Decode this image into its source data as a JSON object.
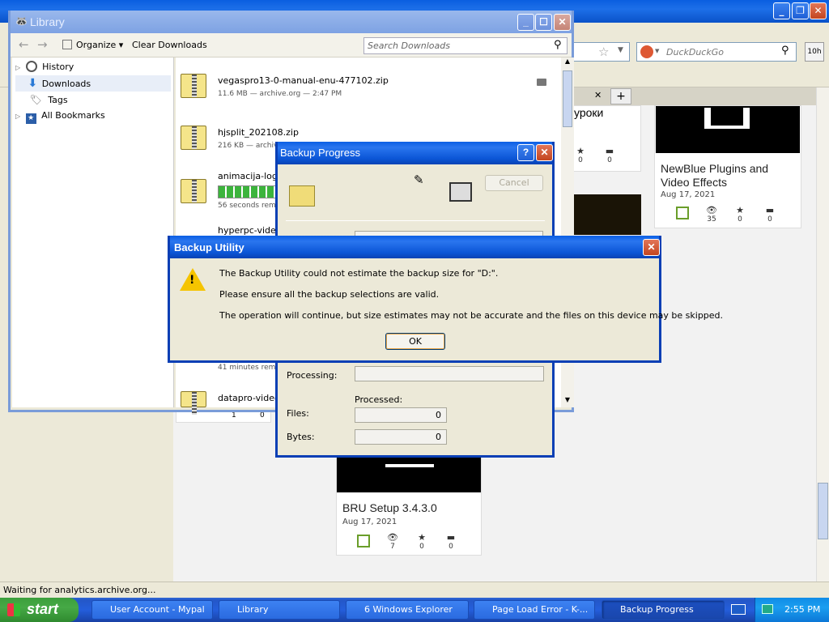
{
  "browser": {
    "search_engine_placeholder": "DuckDuckGo",
    "tab_partial": "уроки",
    "status": "Waiting for analytics.archive.org...",
    "badge": "10h",
    "cards": [
      {
        "title": "NewBlue Plugins and\nVideo Effects",
        "date": "Aug 17, 2021",
        "views": "35",
        "favs": "0",
        "comments": "0"
      },
      {
        "title": "BRU Setup 3.4.3.0",
        "date": "Aug 17, 2021",
        "views": "7",
        "favs": "0",
        "comments": "0"
      }
    ],
    "partial_card": {
      "favs": "0",
      "comments": "0"
    },
    "partial_card_bottom": {
      "a": "1",
      "b": "0"
    }
  },
  "library": {
    "title": "Library",
    "organize": "Organize",
    "clear_downloads": "Clear Downloads",
    "search_placeholder": "Search Downloads",
    "sidebar": [
      {
        "label": "History"
      },
      {
        "label": "Downloads"
      },
      {
        "label": "Tags"
      },
      {
        "label": "All Bookmarks"
      }
    ],
    "downloads": [
      {
        "name": "vegaspro13-0-manual-enu-477102.zip",
        "meta": "11.6 MB — archive.org — 2:47 PM"
      },
      {
        "name": "hjsplit_202108.zip",
        "meta": "216 KB — archiv"
      },
      {
        "name": "animacija-logo-",
        "meta": "56 seconds rema",
        "progress": 0.7
      },
      {
        "name": "hyperpc-videos",
        "meta": ""
      },
      {
        "name": "",
        "meta": "41 minutes rema"
      },
      {
        "name": "datapro-videos",
        "meta": ""
      }
    ]
  },
  "backup_progress": {
    "title": "Backup Progress",
    "cancel": "Cancel",
    "processing_label": "Processing:",
    "processed_label": "Processed:",
    "files_label": "Files:",
    "files_value": "0",
    "bytes_label": "Bytes:",
    "bytes_value": "0"
  },
  "dialog": {
    "title": "Backup Utility",
    "line1": "The Backup Utility could not estimate the backup size for \"D:\".",
    "line2": "Please ensure all the backup selections are valid.",
    "line3": "The operation will continue, but size estimates may not be accurate and the files on this device may be skipped.",
    "ok": "OK"
  },
  "taskbar": {
    "start": "start",
    "items": [
      {
        "label": "User Account - Mypal"
      },
      {
        "label": "Library"
      },
      {
        "label": "6 Windows Explorer"
      },
      {
        "label": "Page Load Error - K-..."
      },
      {
        "label": "Backup Progress"
      }
    ],
    "clock": "2:55 PM"
  }
}
